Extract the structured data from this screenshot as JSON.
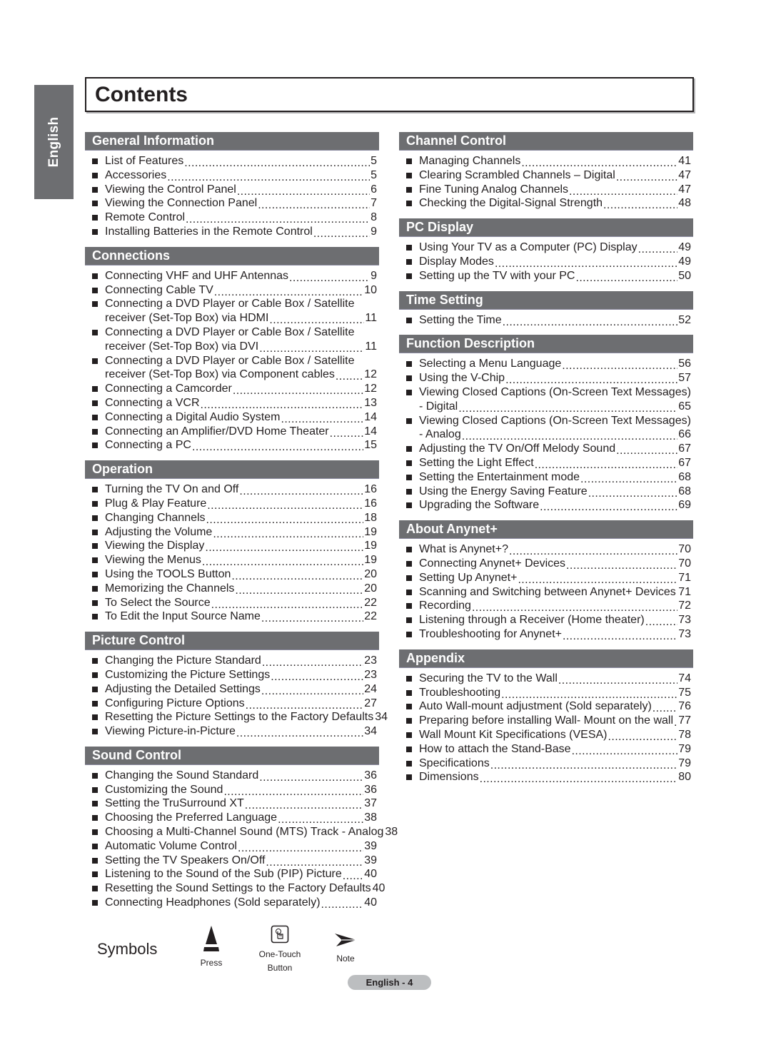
{
  "sidebar_tab": "English",
  "title": "Contents",
  "left_column": [
    {
      "heading": "General Information",
      "items": [
        {
          "text": "List of Features",
          "page": "5"
        },
        {
          "text": "Accessories",
          "page": "5"
        },
        {
          "text": "Viewing the Control Panel",
          "page": "6"
        },
        {
          "text": "Viewing the Connection Panel",
          "page": "7"
        },
        {
          "text": "Remote Control",
          "page": "8"
        },
        {
          "text": "Installing Batteries in the Remote Control",
          "page": "9"
        }
      ]
    },
    {
      "heading": "Connections",
      "items": [
        {
          "text": "Connecting VHF and UHF Antennas",
          "page": "9"
        },
        {
          "text": "Connecting Cable TV",
          "page": "10"
        },
        {
          "text": "Connecting a DVD Player or Cable Box / Satellite",
          "text2": "receiver (Set-Top Box) via HDMI",
          "page": "11"
        },
        {
          "text": "Connecting a DVD Player or Cable Box / Satellite",
          "text2": "receiver (Set-Top Box) via DVI",
          "page": "11"
        },
        {
          "text": "Connecting a DVD Player or Cable Box / Satellite",
          "text2": "receiver (Set-Top Box) via Component cables",
          "page": "12"
        },
        {
          "text": "Connecting a Camcorder",
          "page": "12"
        },
        {
          "text": "Connecting a VCR",
          "page": "13"
        },
        {
          "text": "Connecting a Digital Audio System",
          "page": "14"
        },
        {
          "text": "Connecting an Amplifier/DVD Home Theater",
          "page": "14"
        },
        {
          "text": "Connecting a PC",
          "page": "15"
        }
      ]
    },
    {
      "heading": "Operation",
      "items": [
        {
          "text": "Turning the TV On and Off",
          "page": "16"
        },
        {
          "text": "Plug & Play Feature",
          "page": "16"
        },
        {
          "text": "Changing Channels",
          "page": "18"
        },
        {
          "text": "Adjusting the Volume",
          "page": "19"
        },
        {
          "text": "Viewing the Display",
          "page": "19"
        },
        {
          "text": "Viewing the Menus",
          "page": "19"
        },
        {
          "text": "Using the TOOLS Button",
          "page": "20"
        },
        {
          "text": "Memorizing the Channels",
          "page": "20"
        },
        {
          "text": "To Select the Source",
          "page": "22"
        },
        {
          "text": "To Edit the Input Source Name",
          "page": "22"
        }
      ]
    },
    {
      "heading": "Picture Control",
      "items": [
        {
          "text": "Changing the Picture Standard",
          "page": "23"
        },
        {
          "text": "Customizing the Picture Settings",
          "page": "23"
        },
        {
          "text": "Adjusting the Detailed Settings",
          "page": "24"
        },
        {
          "text": "Configuring Picture Options",
          "page": "27"
        },
        {
          "text": "Resetting the Picture Settings to the Factory Defaults",
          "page": "34"
        },
        {
          "text": "Viewing Picture-in-Picture",
          "page": "34"
        }
      ]
    },
    {
      "heading": "Sound Control",
      "items": [
        {
          "text": "Changing the Sound Standard",
          "page": "36"
        },
        {
          "text": "Customizing the Sound",
          "page": "36"
        },
        {
          "text": "Setting the TruSurround XT",
          "page": "37"
        },
        {
          "text": "Choosing the Preferred Language",
          "page": "38"
        },
        {
          "text": "Choosing a Multi-Channel Sound (MTS) Track - Analog",
          "page": "38"
        },
        {
          "text": "Automatic Volume Control",
          "page": "39"
        },
        {
          "text": "Setting the TV Speakers On/Off",
          "page": "39"
        },
        {
          "text": "Listening to the Sound of the Sub (PIP) Picture",
          "page": "40"
        },
        {
          "text": "Resetting the Sound Settings to the Factory Defaults",
          "page": "40"
        },
        {
          "text": "Connecting Headphones (Sold separately)",
          "page": "40"
        }
      ]
    }
  ],
  "right_column": [
    {
      "heading": "Channel Control",
      "items": [
        {
          "text": "Managing Channels",
          "page": "41"
        },
        {
          "text": "Clearing Scrambled Channels – Digital",
          "page": "47"
        },
        {
          "text": "Fine Tuning Analog Channels",
          "page": "47"
        },
        {
          "text": "Checking the Digital-Signal Strength",
          "page": "48"
        }
      ]
    },
    {
      "heading": "PC Display",
      "items": [
        {
          "text": "Using Your TV as a Computer (PC) Display",
          "page": "49"
        },
        {
          "text": "Display Modes",
          "page": "49"
        },
        {
          "text": "Setting up the TV with your PC",
          "page": "50"
        }
      ]
    },
    {
      "heading": "Time Setting",
      "items": [
        {
          "text": "Setting the Time",
          "page": "52"
        }
      ]
    },
    {
      "heading": "Function Description",
      "items": [
        {
          "text": "Selecting a Menu Language",
          "page": "56"
        },
        {
          "text": "Using the V-Chip",
          "page": "57"
        },
        {
          "text": "Viewing Closed Captions (On-Screen Text Messages)",
          "text2": "- Digital",
          "page": "65"
        },
        {
          "text": "Viewing Closed Captions (On-Screen Text Messages)",
          "text2": "- Analog",
          "page": "66"
        },
        {
          "text": "Adjusting the TV On/Off Melody Sound",
          "page": "67"
        },
        {
          "text": "Setting the Light Effect",
          "page": "67"
        },
        {
          "text": "Setting the Entertainment mode",
          "page": "68"
        },
        {
          "text": "Using the Energy Saving Feature",
          "page": "68"
        },
        {
          "text": "Upgrading the Software",
          "page": "69"
        }
      ]
    },
    {
      "heading": "About Anynet+",
      "items": [
        {
          "text": "What is Anynet+?",
          "page": "70"
        },
        {
          "text": "Connecting Anynet+ Devices",
          "page": "70"
        },
        {
          "text": "Setting Up Anynet+",
          "page": "71"
        },
        {
          "text": "Scanning and Switching between Anynet+ Devices",
          "page": "71"
        },
        {
          "text": "Recording",
          "page": "72"
        },
        {
          "text": "Listening through a Receiver (Home theater)",
          "page": "73"
        },
        {
          "text": "Troubleshooting for Anynet+",
          "page": "73"
        }
      ]
    },
    {
      "heading": "Appendix",
      "items": [
        {
          "text": "Securing the TV to the Wall",
          "page": "74"
        },
        {
          "text": "Troubleshooting",
          "page": "75"
        },
        {
          "text": "Auto Wall-mount adjustment (Sold separately)",
          "page": "76"
        },
        {
          "text": "Preparing before installing Wall- Mount on the wall",
          "page": "77"
        },
        {
          "text": "Wall Mount Kit Specifications (VESA)",
          "page": "78"
        },
        {
          "text": "How to attach the Stand-Base",
          "page": "79"
        },
        {
          "text": "Specifications",
          "page": "79"
        },
        {
          "text": "Dimensions",
          "page": "80"
        }
      ]
    }
  ],
  "symbols": {
    "title": "Symbols",
    "press": {
      "icon": "press-triangle-icon",
      "label": "Press"
    },
    "one_touch": {
      "icon": "one-touch-button-icon",
      "label_line1": "One-Touch",
      "label_line2": "Button"
    },
    "note": {
      "icon": "note-arrow-icon",
      "label": "Note"
    }
  },
  "footer": {
    "page_label": "English - 4"
  }
}
